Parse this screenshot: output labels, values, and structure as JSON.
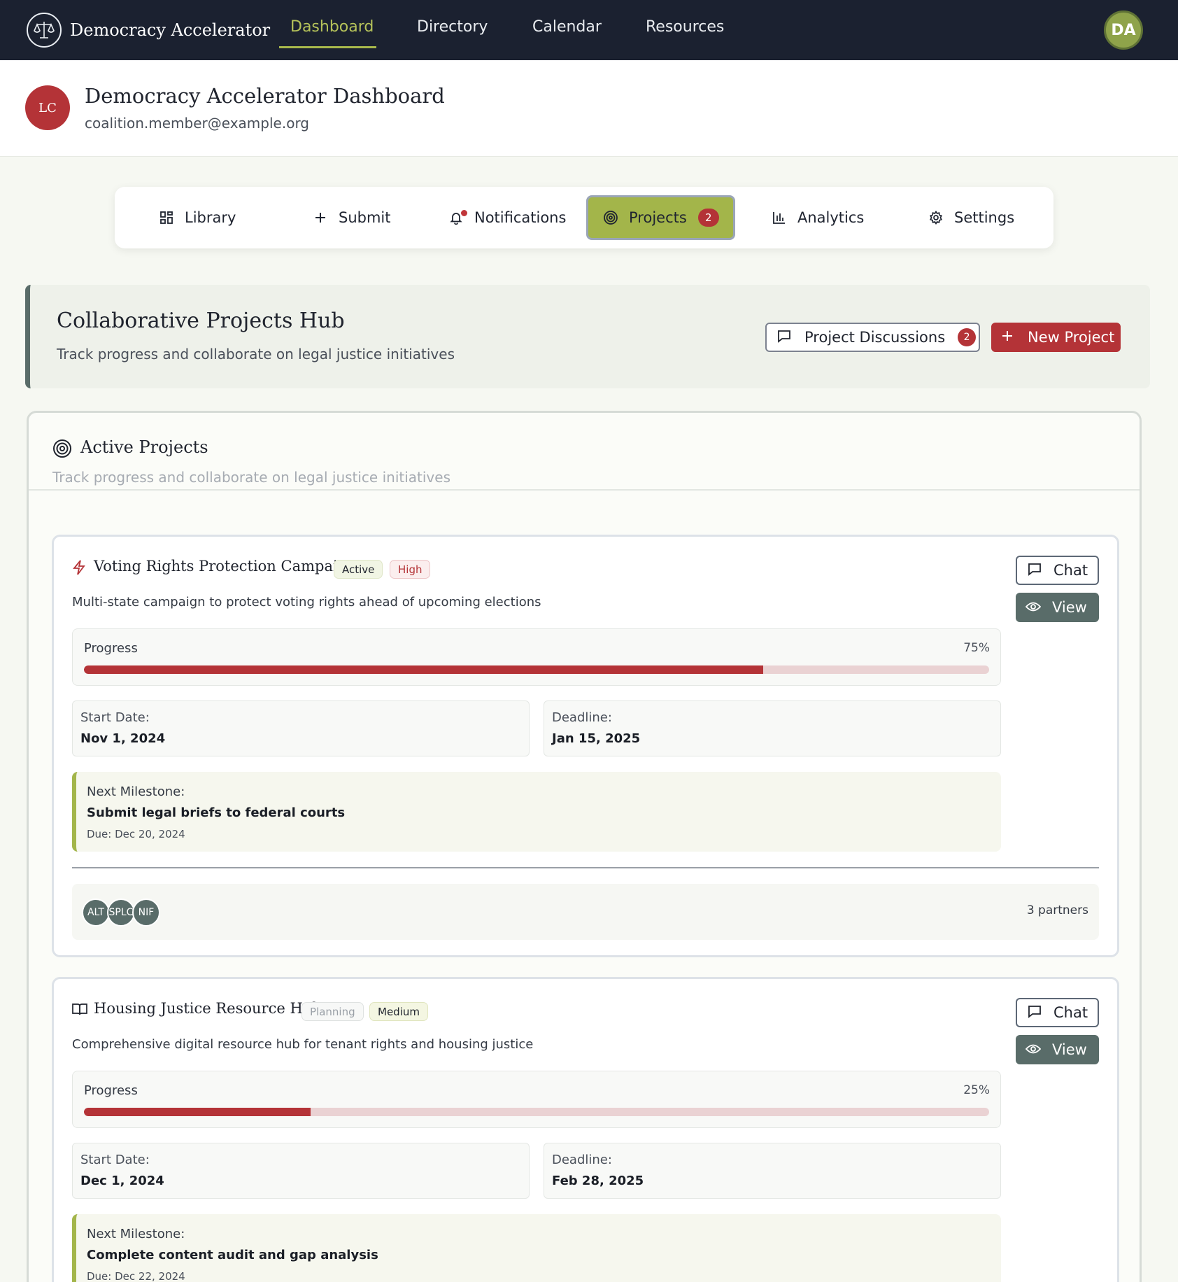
{
  "nav": {
    "brand": "Democracy Accelerator",
    "links": [
      "Dashboard",
      "Directory",
      "Calendar",
      "Resources"
    ],
    "active": "Dashboard",
    "user_initials": "DA"
  },
  "header": {
    "avatar_initials": "LC",
    "title": "Democracy Accelerator Dashboard",
    "email": "coalition.member@example.org"
  },
  "tabs": [
    {
      "label": "Library",
      "icon": "grid-icon"
    },
    {
      "label": "Submit",
      "icon": "plus-icon"
    },
    {
      "label": "Notifications",
      "icon": "bell-icon"
    },
    {
      "label": "Projects",
      "icon": "target-icon",
      "badge": "2",
      "active": true
    },
    {
      "label": "Analytics",
      "icon": "bar-chart-icon"
    },
    {
      "label": "Settings",
      "icon": "gear-icon"
    }
  ],
  "hub": {
    "title": "Collaborative Projects Hub",
    "subtitle": "Track progress and collaborate on legal justice initiatives",
    "discussions_label": "Project Discussions",
    "discussions_badge": "2",
    "new_project_label": "New Project"
  },
  "panel": {
    "title": "Active Projects",
    "subtitle": "Track progress and collaborate on legal justice initiatives"
  },
  "projects": [
    {
      "title": "Voting Rights Protection Campaign",
      "icon": "lightning-icon",
      "status": "Active",
      "priority": "High",
      "description": "Multi-state campaign to protect voting rights ahead of upcoming elections",
      "progress_label": "Progress",
      "progress": 75,
      "progress_text": "75%",
      "start_label": "Start Date:",
      "start_date": "Nov 1, 2024",
      "deadline_label": "Deadline:",
      "deadline": "Jan 15, 2025",
      "milestone_label": "Next Milestone:",
      "milestone": "Submit legal briefs to federal courts",
      "milestone_due": "Due: Dec 20, 2024",
      "partners": [
        "ALT",
        "SPLC",
        "NIF"
      ],
      "partners_count": "3 partners",
      "chat_label": "Chat",
      "view_label": "View"
    },
    {
      "title": "Housing Justice Resource Hub",
      "icon": "book-icon",
      "status": "Planning",
      "priority": "Medium",
      "description": "Comprehensive digital resource hub for tenant rights and housing justice",
      "progress_label": "Progress",
      "progress": 25,
      "progress_text": "25%",
      "start_label": "Start Date:",
      "start_date": "Dec 1, 2024",
      "deadline_label": "Deadline:",
      "deadline": "Feb 28, 2025",
      "milestone_label": "Next Milestone:",
      "milestone": "Complete content audit and gap analysis",
      "milestone_due": "Due: Dec 22, 2024",
      "chat_label": "Chat",
      "view_label": "View"
    }
  ],
  "colors": {
    "nav_bg": "#1b2130",
    "accent_green": "#a3b54a",
    "brand_red": "#b43337",
    "slate": "#596c69"
  }
}
